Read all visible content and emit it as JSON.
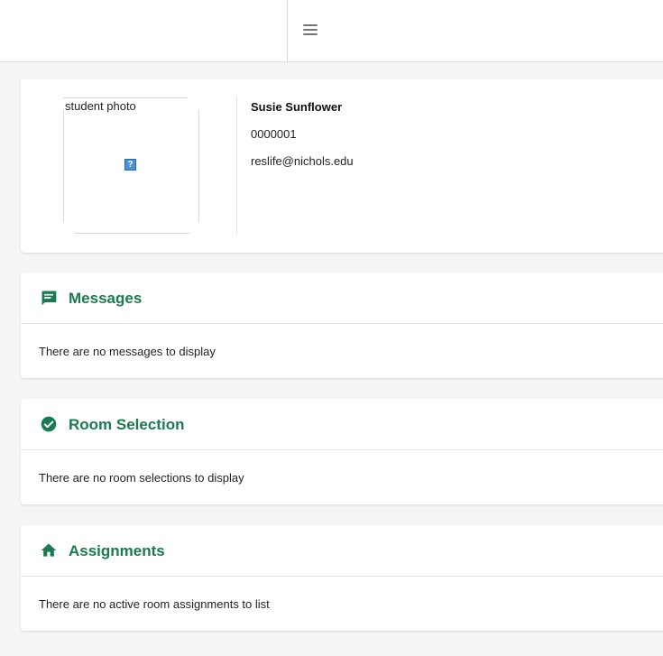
{
  "header": {
    "menu_icon": "hamburger-menu-icon"
  },
  "profile": {
    "photo_alt": "student photo",
    "broken_image_icon": "broken-image-icon",
    "broken_image_glyph": "?",
    "name": "Susie Sunflower",
    "student_id": "0000001",
    "email": "reslife@nichols.edu"
  },
  "sections": {
    "messages": {
      "icon": "message-icon",
      "title": "Messages",
      "empty_text": "There are no messages to display"
    },
    "room_selection": {
      "icon": "check-circle-icon",
      "title": "Room Selection",
      "empty_text": "There are no room selections to display"
    },
    "assignments": {
      "icon": "home-icon",
      "title": "Assignments",
      "empty_text": "There are no active room assignments to list"
    }
  },
  "colors": {
    "accent": "#1b7a4f",
    "page_background": "#f5f5f5",
    "card_background": "#ffffff"
  }
}
